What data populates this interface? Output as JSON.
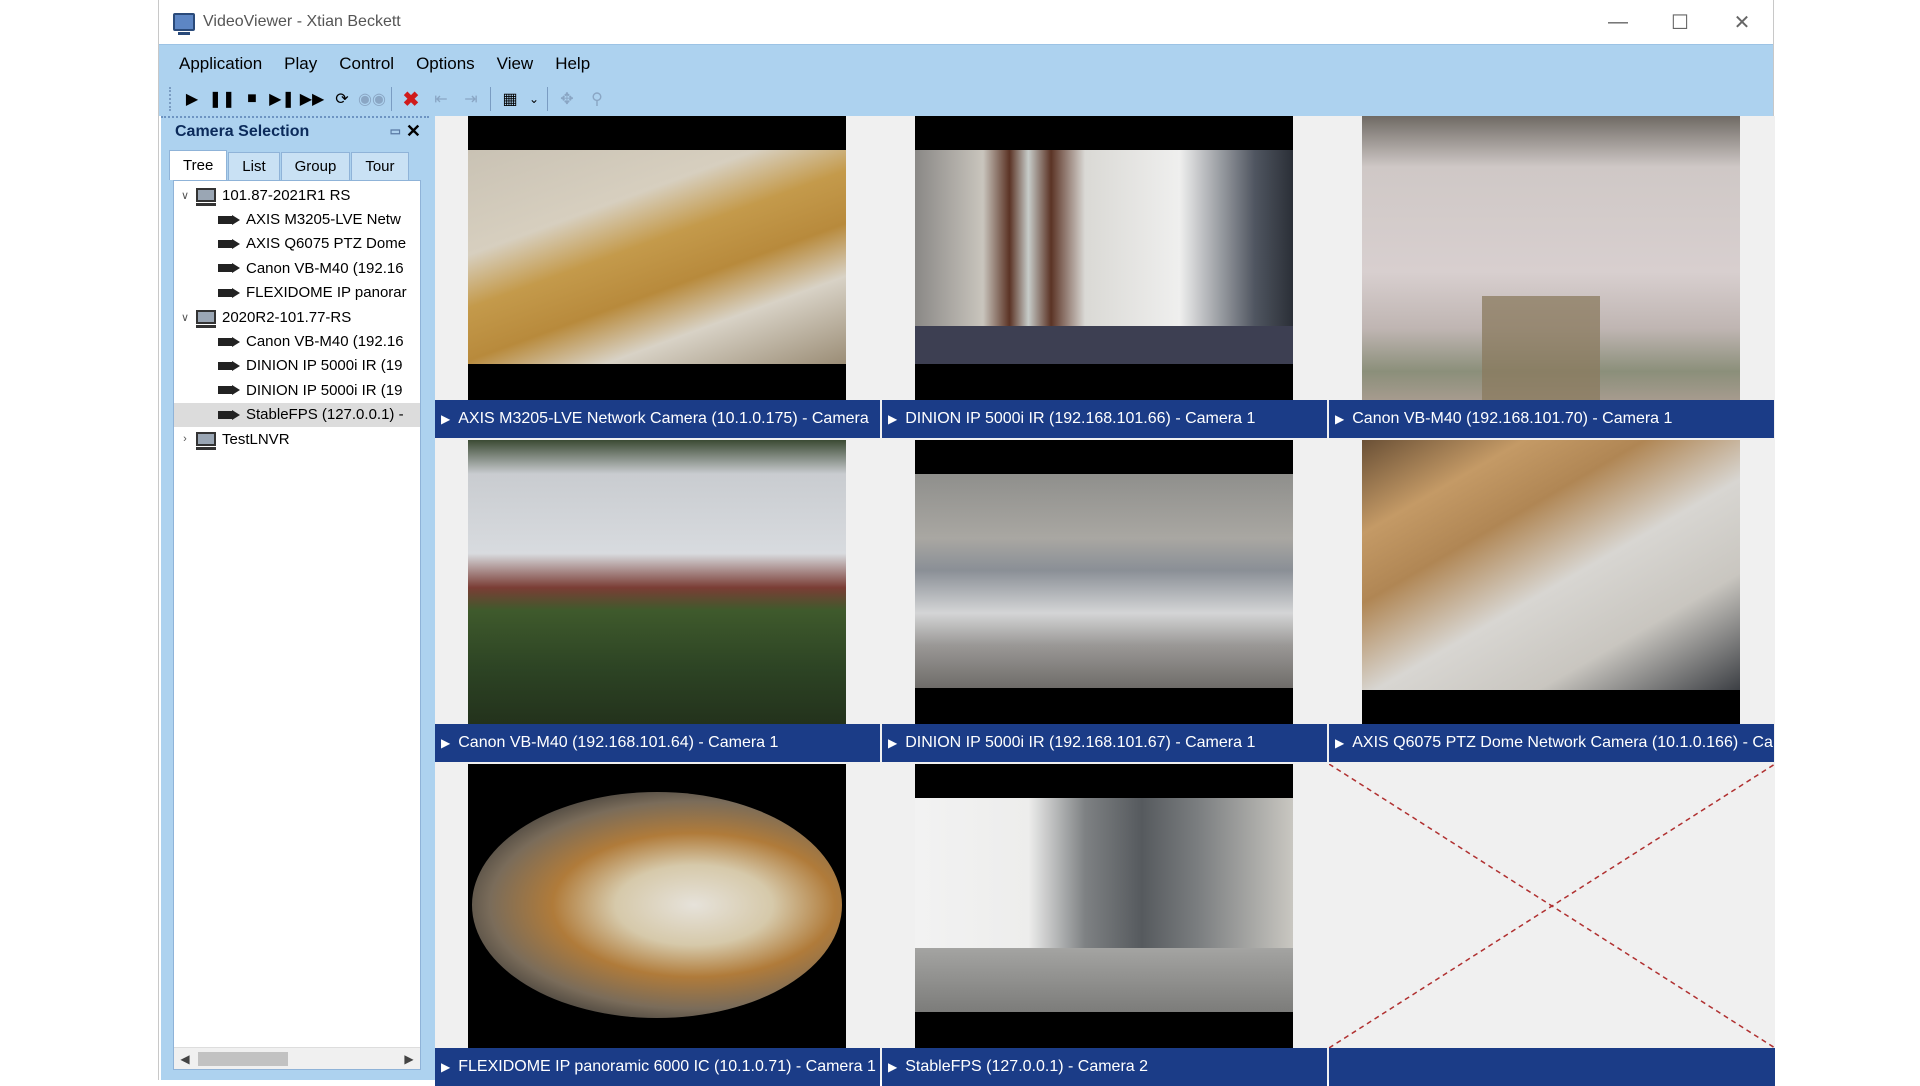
{
  "window": {
    "title": "VideoViewer - Xtian Beckett"
  },
  "menu": [
    "Application",
    "Play",
    "Control",
    "Options",
    "View",
    "Help"
  ],
  "panel": {
    "title": "Camera Selection",
    "tabs": [
      "Tree",
      "List",
      "Group",
      "Tour"
    ],
    "tree": [
      {
        "label": "101.87-2021R1 RS",
        "type": "server",
        "level": 0,
        "expanded": true
      },
      {
        "label": "AXIS M3205-LVE Netw",
        "type": "camera",
        "level": 1
      },
      {
        "label": "AXIS Q6075 PTZ Dome",
        "type": "camera",
        "level": 1
      },
      {
        "label": "Canon VB-M40 (192.16",
        "type": "camera",
        "level": 1
      },
      {
        "label": "FLEXIDOME IP panorar",
        "type": "camera",
        "level": 1
      },
      {
        "label": "2020R2-101.77-RS",
        "type": "server",
        "level": 0,
        "expanded": true
      },
      {
        "label": "Canon VB-M40 (192.16",
        "type": "camera",
        "level": 1
      },
      {
        "label": "DINION IP 5000i IR (19",
        "type": "camera",
        "level": 1
      },
      {
        "label": "DINION IP 5000i IR (19",
        "type": "camera",
        "level": 1
      },
      {
        "label": "StableFPS (127.0.0.1) -",
        "type": "camera",
        "level": 1,
        "selected": true
      },
      {
        "label": "TestLNVR",
        "type": "server",
        "level": 0,
        "expanded": false
      }
    ]
  },
  "cells": [
    "AXIS M3205-LVE Network Camera (10.1.0.175) - Camera",
    "DINION IP 5000i IR (192.168.101.66) - Camera 1",
    "Canon VB-M40 (192.168.101.70) - Camera 1",
    "Canon VB-M40 (192.168.101.64) - Camera 1",
    "DINION IP 5000i IR (192.168.101.67) - Camera 1",
    "AXIS Q6075 PTZ Dome Network Camera (10.1.0.166) - Ca",
    "FLEXIDOME IP panoramic 6000 IC (10.1.0.71) - Camera 1",
    "StableFPS (127.0.0.1) - Camera 2",
    ""
  ],
  "colors": {
    "accent": "#add2ef",
    "caption": "#1b3c87",
    "empty_x": "#b03030"
  }
}
